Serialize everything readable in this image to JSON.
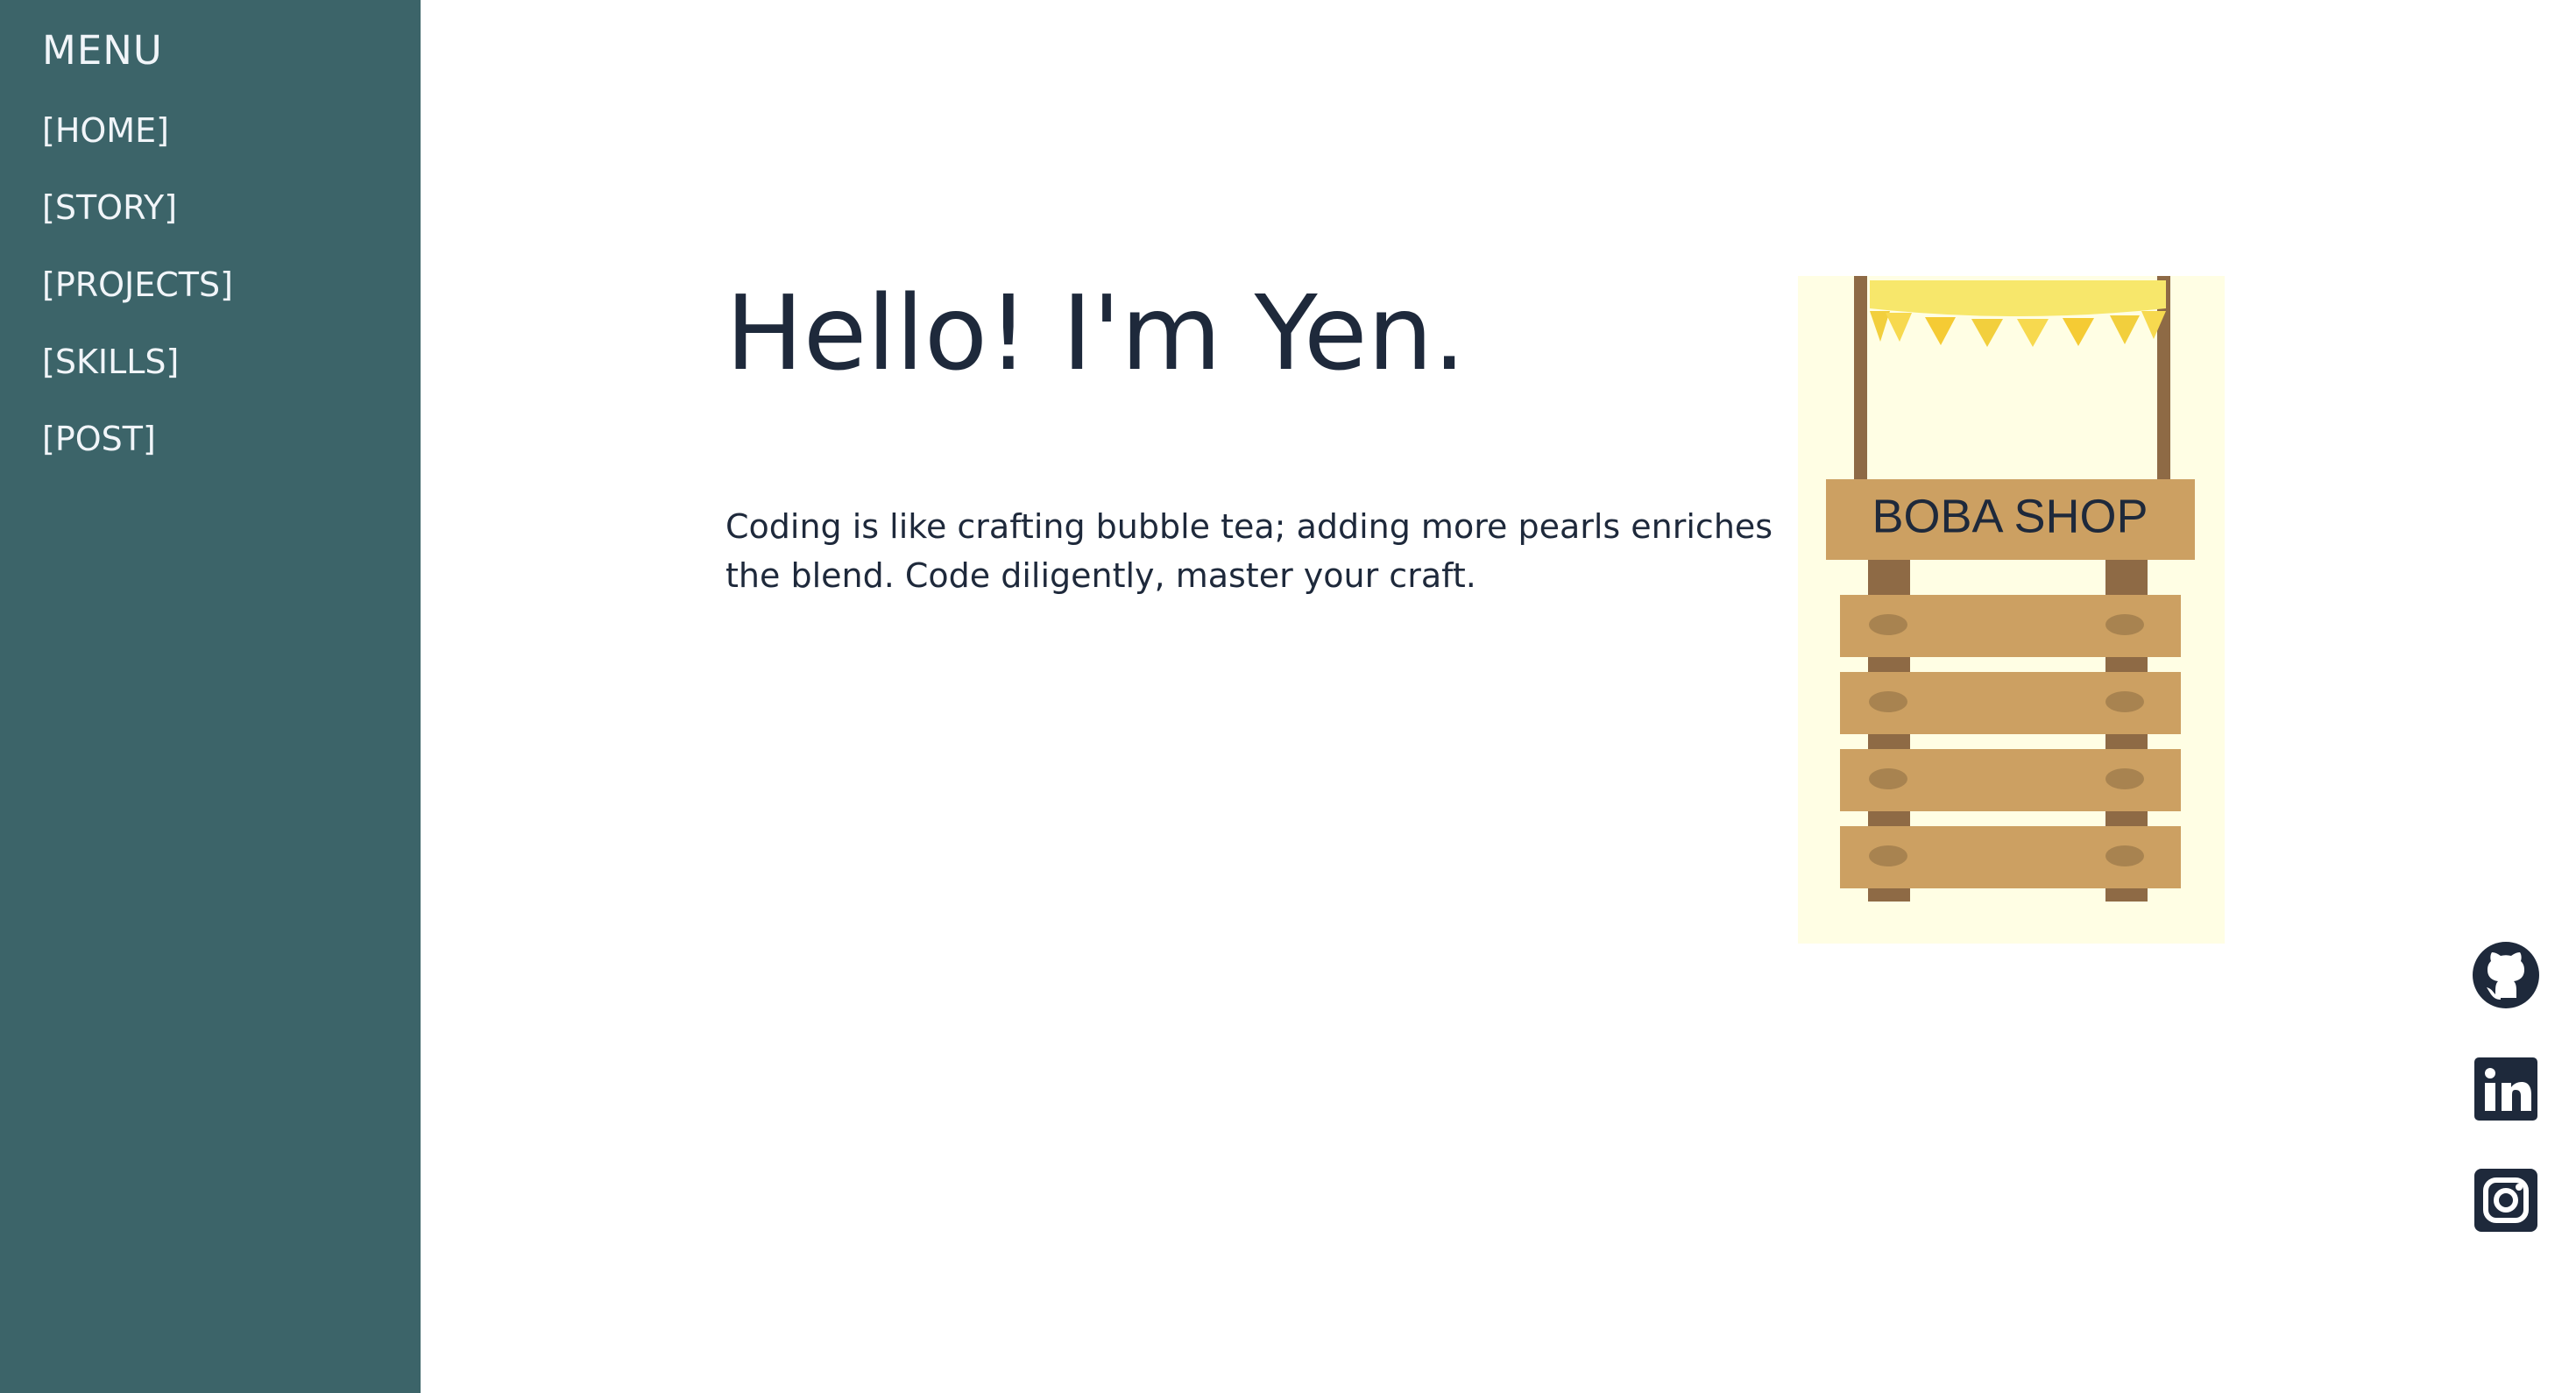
{
  "sidebar": {
    "title": "MENU",
    "items": [
      {
        "label": "[HOME]"
      },
      {
        "label": "[STORY]"
      },
      {
        "label": "[PROJECTS]"
      },
      {
        "label": "[SKILLS]"
      },
      {
        "label": "[POST]"
      }
    ]
  },
  "hero": {
    "title": "Hello! I'm Yen.",
    "description": "Coding is like crafting bubble tea; adding more pearls enriches the blend. Code diligently, master your craft."
  },
  "illustration": {
    "sign_text": "BOBA SHOP"
  },
  "social": {
    "icons": [
      "github-icon",
      "linkedin-icon",
      "instagram-icon"
    ]
  },
  "colors": {
    "sidebar": "#3c6469",
    "text": "#1e293b",
    "illustration_background": "#fffee4",
    "wood": "#cca062",
    "wood_dark": "#8e6a45",
    "banner": "#f7d94f"
  }
}
